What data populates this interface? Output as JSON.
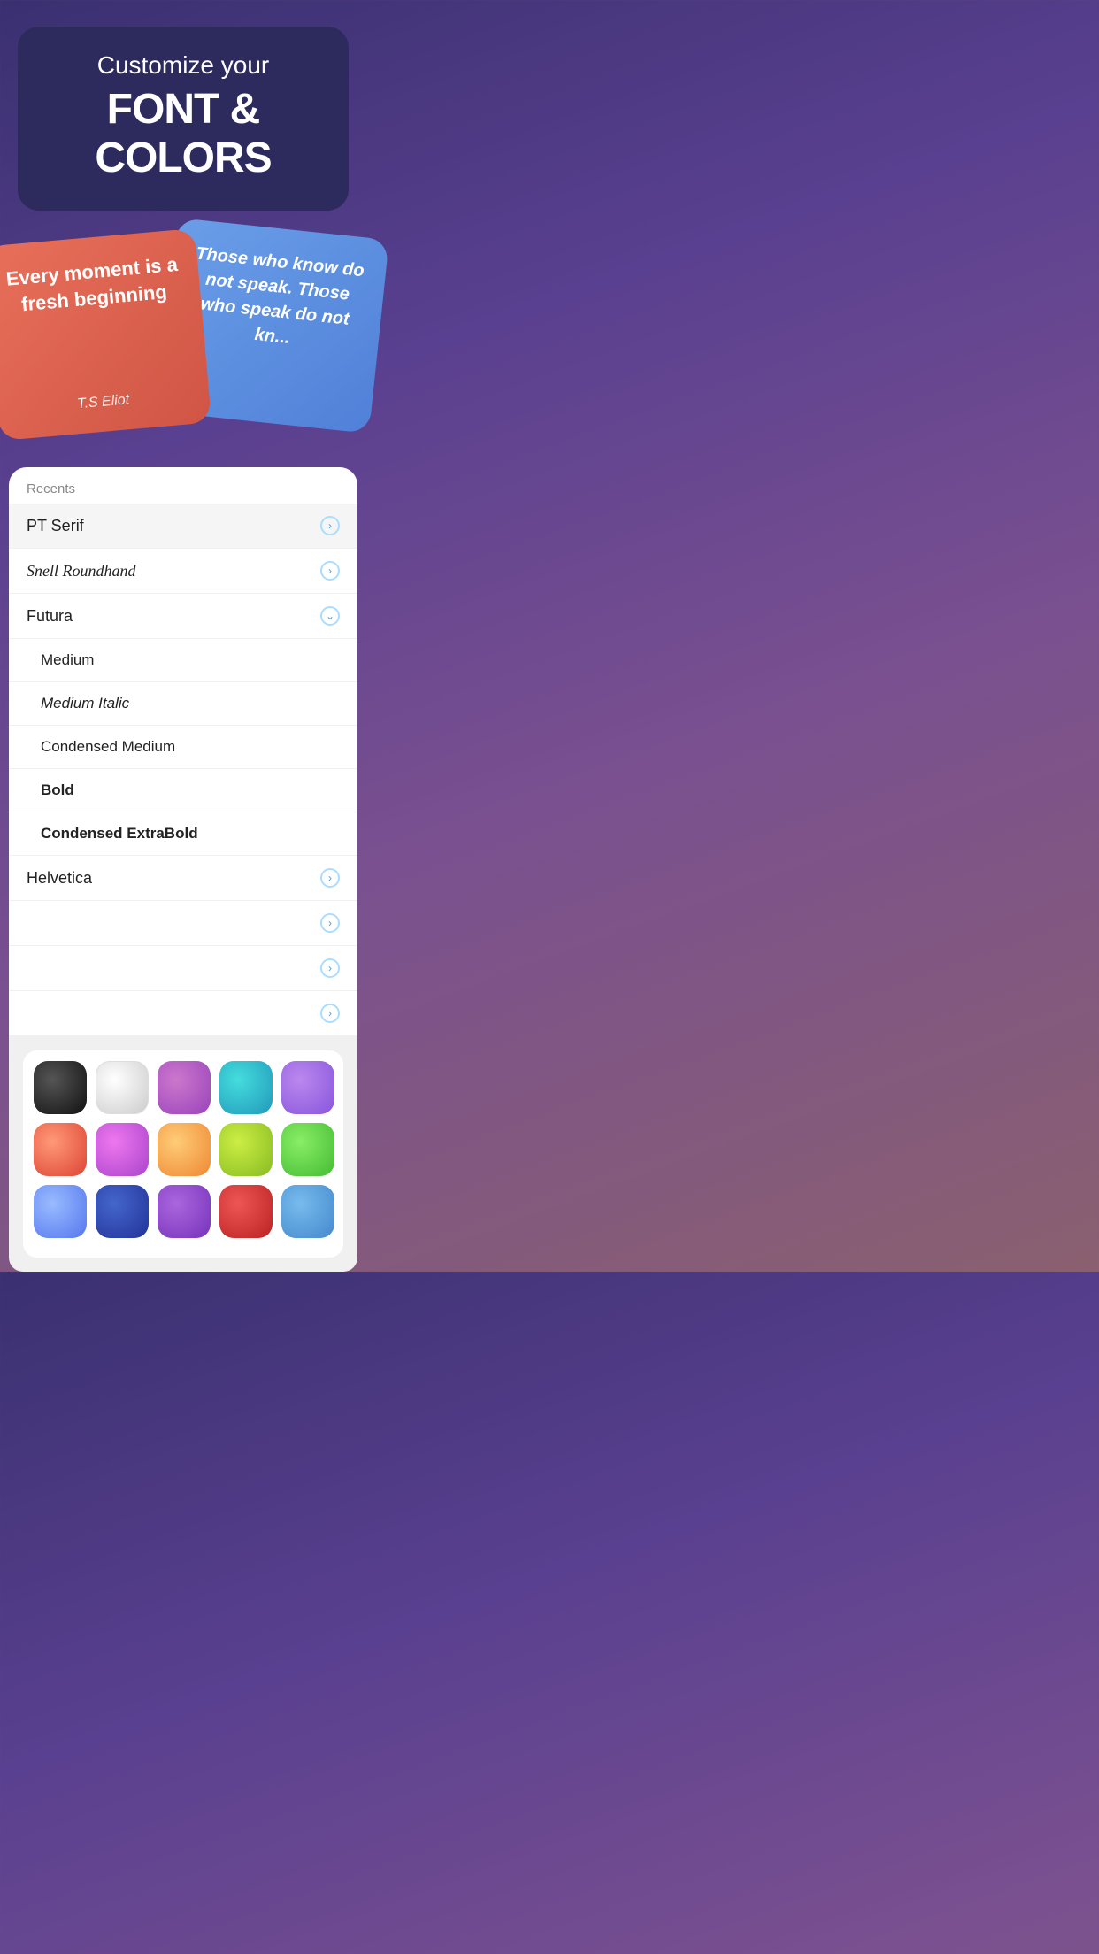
{
  "header": {
    "subtitle": "Customize your",
    "title": "FONT & COLORS"
  },
  "cards": {
    "red": {
      "quote": "Every moment is a fresh beginning",
      "author": "T.S Eliot"
    },
    "blue": {
      "quote": "Those who know do not speak. Those who speak do not kn..."
    }
  },
  "font_picker": {
    "recents_label": "Recents",
    "fonts": [
      {
        "name": "PT Serif",
        "style": "normal",
        "has_children": false,
        "expanded": false,
        "chevron": "right",
        "highlighted": true
      },
      {
        "name": "Snell Roundhand",
        "style": "snell",
        "has_children": false,
        "expanded": false,
        "chevron": "right"
      },
      {
        "name": "Futura",
        "style": "normal",
        "has_children": true,
        "expanded": true,
        "chevron": "down"
      }
    ],
    "futura_children": [
      {
        "name": "Medium",
        "style": "normal"
      },
      {
        "name": "Medium Italic",
        "style": "italic"
      },
      {
        "name": "Condensed Medium",
        "style": "normal"
      },
      {
        "name": "Bold",
        "style": "bold"
      },
      {
        "name": "Condensed ExtraBold",
        "style": "condensed-extrabold"
      }
    ],
    "more_fonts": [
      {
        "name": "Helvetica"
      },
      {
        "name": ""
      },
      {
        "name": ""
      },
      {
        "name": ""
      }
    ]
  },
  "colors": {
    "rows": [
      [
        "black",
        "white",
        "purple-pink",
        "cyan",
        "lavender"
      ],
      [
        "red-orange",
        "pink-purple",
        "orange",
        "yellow-green",
        "green"
      ],
      [
        "blue-light",
        "dark-blue",
        "violet",
        "red",
        "sky-blue"
      ]
    ]
  }
}
